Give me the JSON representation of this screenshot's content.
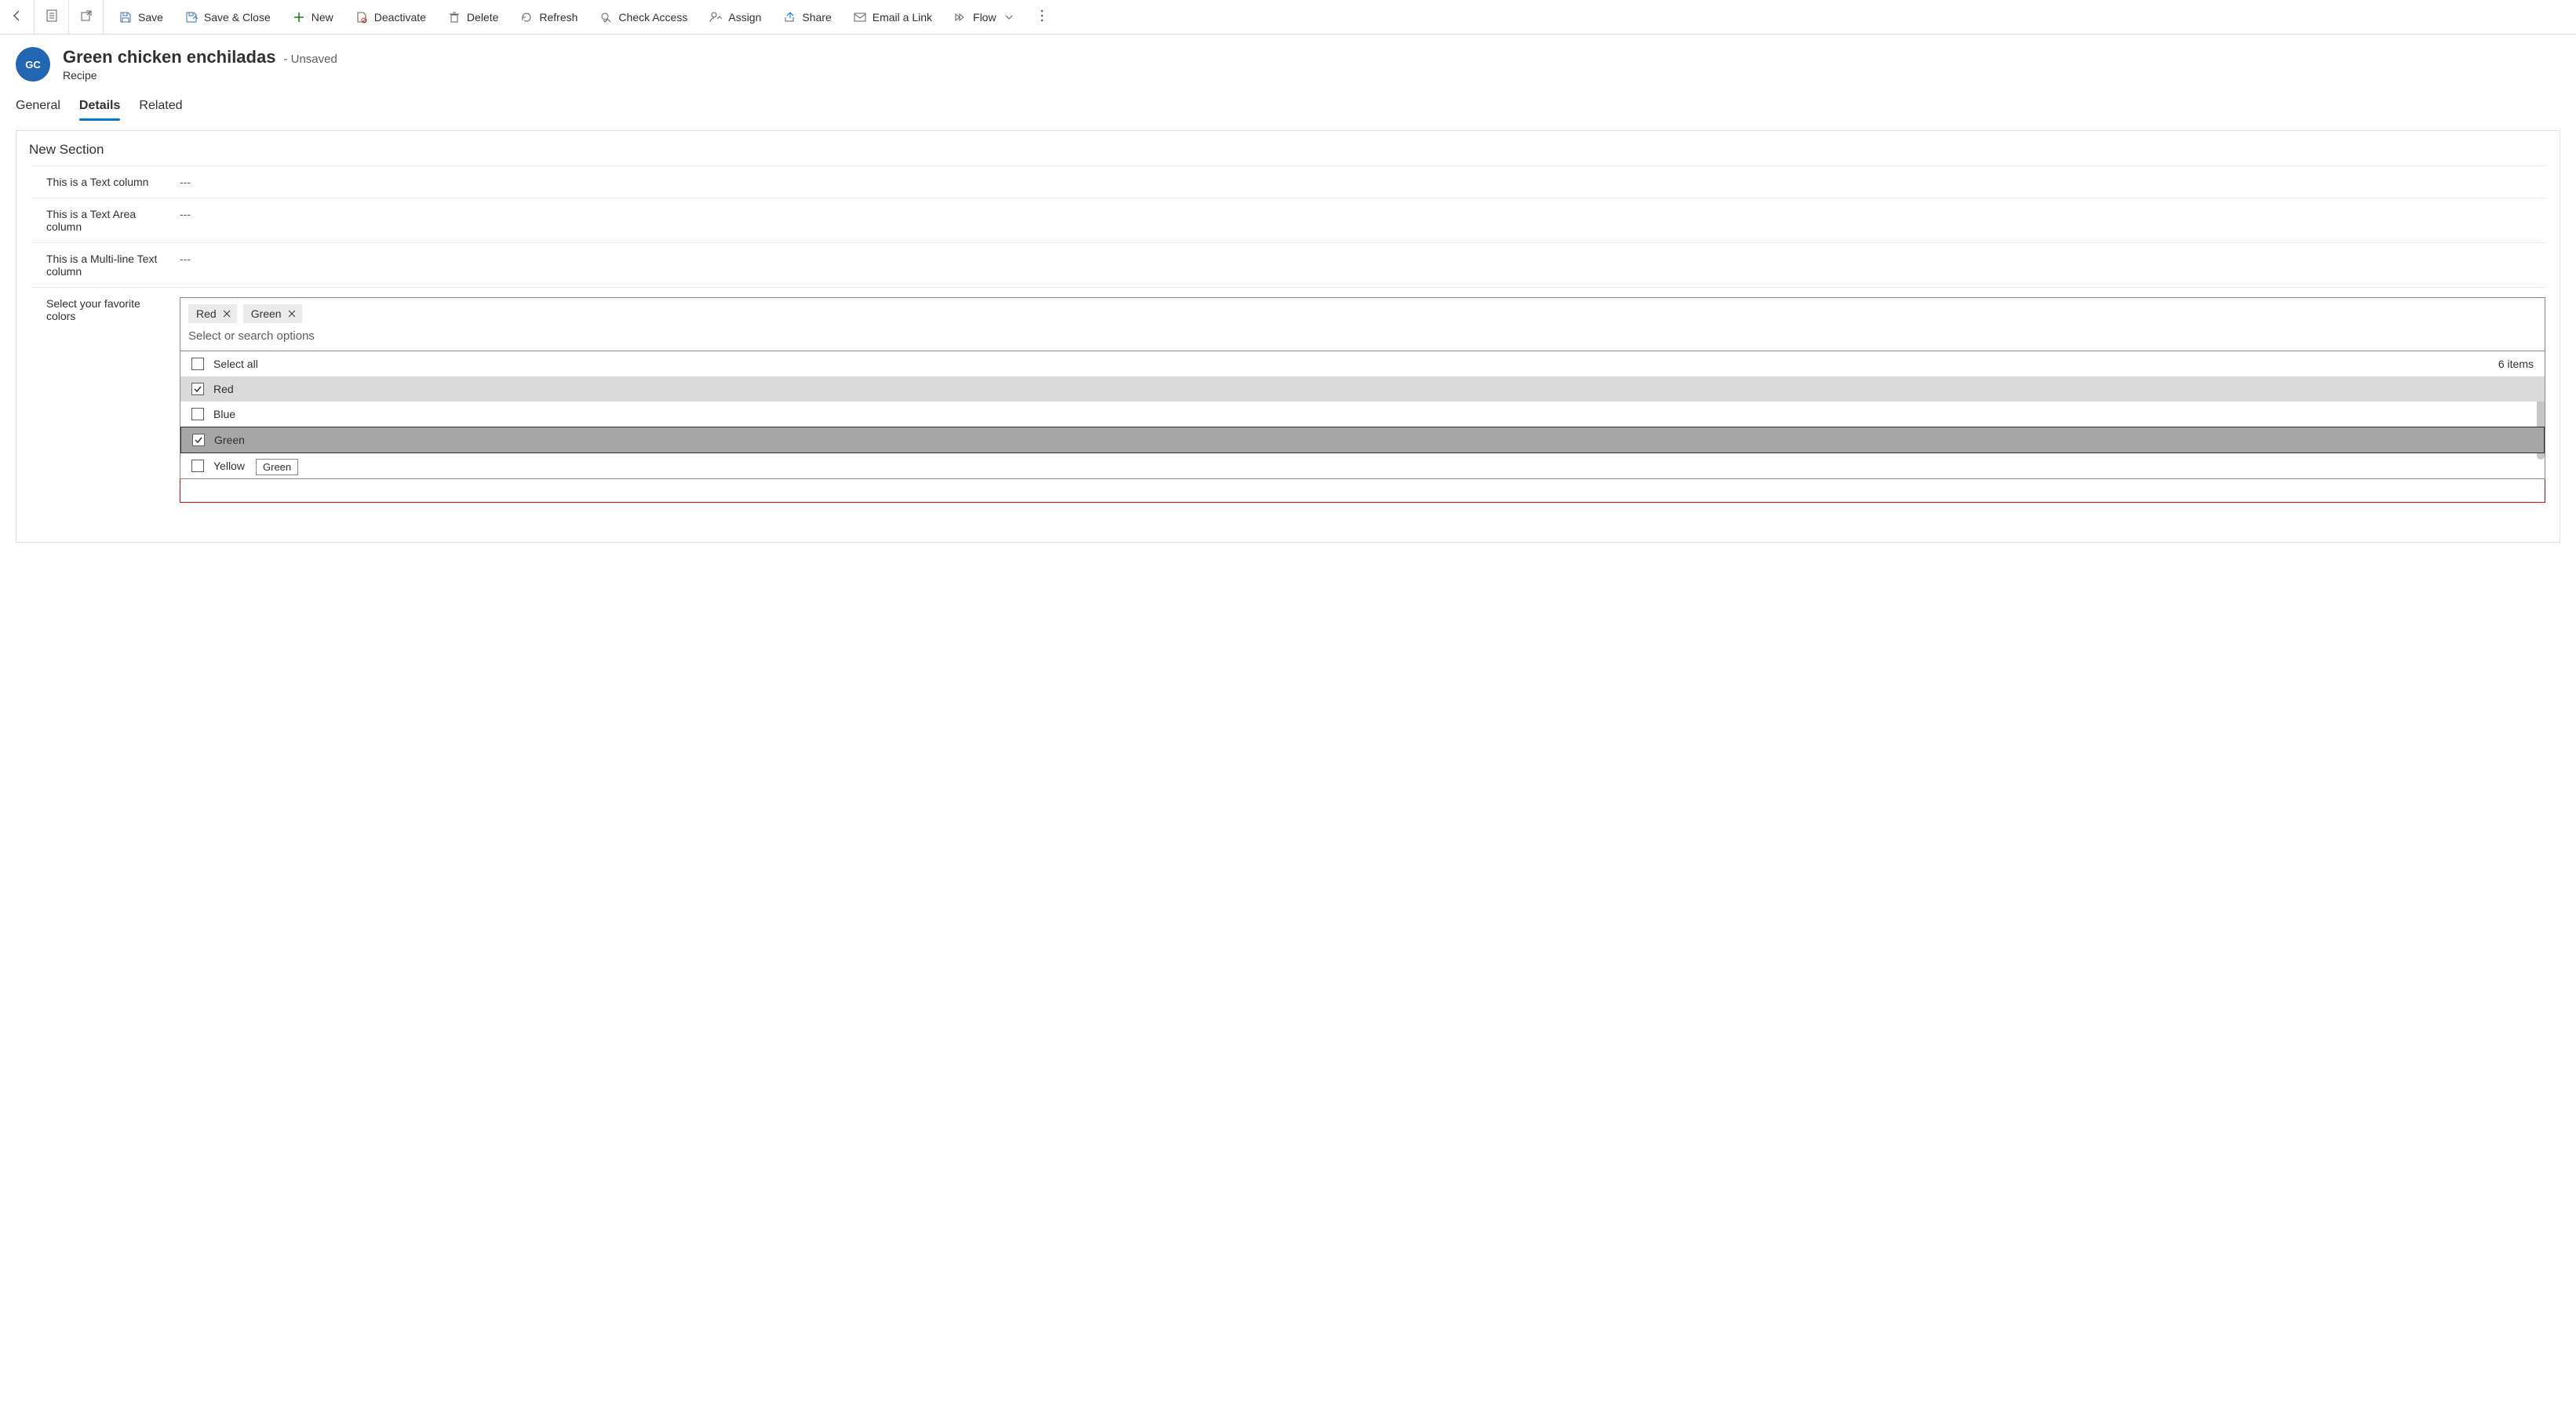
{
  "commands": {
    "save": "Save",
    "save_close": "Save & Close",
    "new": "New",
    "deactivate": "Deactivate",
    "delete": "Delete",
    "refresh": "Refresh",
    "check_access": "Check Access",
    "assign": "Assign",
    "share": "Share",
    "email_link": "Email a Link",
    "flow": "Flow"
  },
  "record": {
    "avatar_initials": "GC",
    "title": "Green chicken enchiladas",
    "state": "- Unsaved",
    "entity": "Recipe"
  },
  "tabs": {
    "general": "General",
    "details": "Details",
    "related": "Related"
  },
  "section": {
    "title": "New Section",
    "text_col_label": "This is a Text column",
    "text_col_value": "---",
    "textarea_label": "This is a Text Area column",
    "textarea_value": "---",
    "multiline_label": "This is a Multi-line Text column",
    "multiline_value": "---",
    "colors_label": "Select your favorite colors"
  },
  "multiselect": {
    "tag1": "Red",
    "tag2": "Green",
    "placeholder": "Select or search options",
    "select_all": "Select all",
    "count": "6 items",
    "opt_red": "Red",
    "opt_blue": "Blue",
    "opt_green": "Green",
    "opt_yellow": "Yellow",
    "tooltip": "Green"
  }
}
